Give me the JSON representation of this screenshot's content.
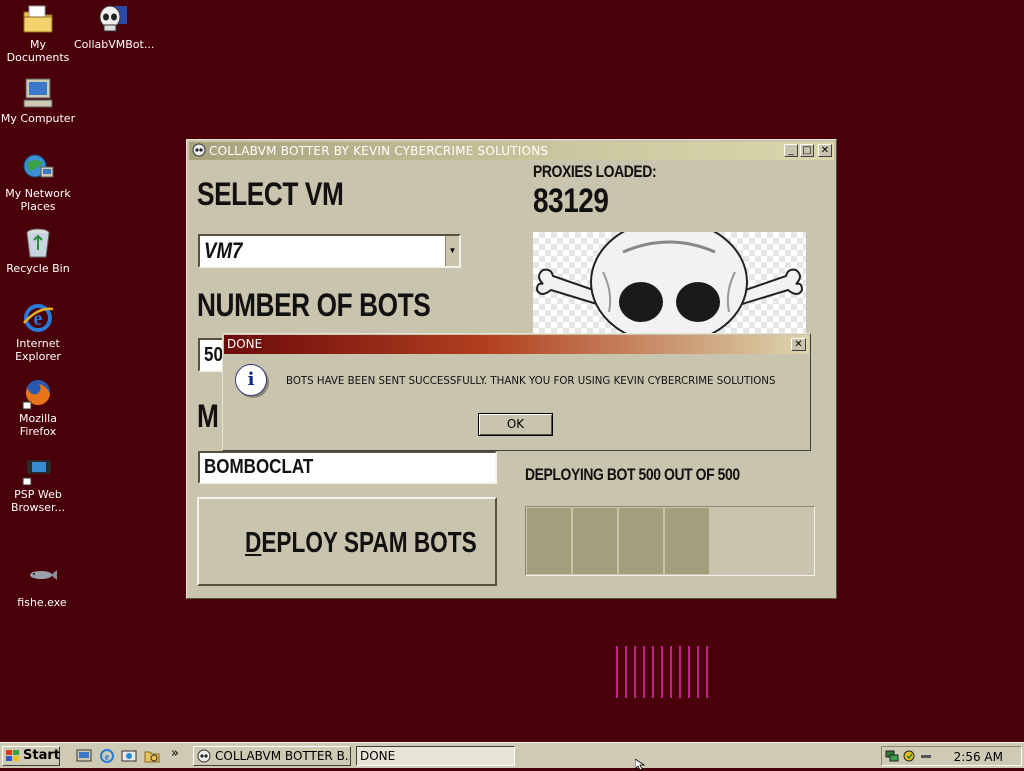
{
  "desktop": {
    "icons": [
      {
        "label": "My Documents",
        "icon": "folder-documents-icon"
      },
      {
        "label": "CollabVMBot...",
        "icon": "skull-app-icon"
      },
      {
        "label": "My Computer",
        "icon": "computer-icon"
      },
      {
        "label": "My Network Places",
        "icon": "network-icon"
      },
      {
        "label": "Recycle Bin",
        "icon": "recycle-bin-icon"
      },
      {
        "label": "Internet Explorer",
        "icon": "internet-explorer-icon"
      },
      {
        "label": "Mozilla Firefox",
        "icon": "firefox-icon"
      },
      {
        "label": "PSP Web Browser...",
        "icon": "psp-icon"
      },
      {
        "label": "fishe.exe",
        "icon": "fish-icon"
      }
    ],
    "background_color": "#4a0009"
  },
  "window": {
    "title": "COLLABVM BOTTER BY KEVIN CYBERCRIME SOLUTIONS",
    "minimize_glyph": "_",
    "maximize_glyph": "□",
    "close_glyph": "✕",
    "select_vm_heading": "SELECT VM",
    "vm_value": "VM7",
    "dropdown_arrow": "▼",
    "number_of_bots_heading": "NUMBER OF BOTS",
    "bots_value_visible": "50",
    "message_heading_visible": "M",
    "message_value": "BOMBOCLAT",
    "deploy_button_label": "DEPLOY SPAM BOTS",
    "proxies_label": "PROXIES LOADED:",
    "proxies_count": "83129",
    "deploy_status": "DEPLOYING BOT 500 OUT OF 500",
    "progress_fraction": 0.64
  },
  "dialog": {
    "title": "DONE",
    "close_glyph": "✕",
    "icon": "info-icon",
    "message": "BOTS HAVE BEEN SENT SUCCESSFULLY. THANK YOU FOR USING KEVIN CYBERCRIME SOLUTIONS",
    "ok_label": "OK"
  },
  "taskbar": {
    "start_label": "Start",
    "quick_launch": [
      "show-desktop-icon",
      "internet-explorer-icon",
      "media-icon",
      "explorer-icon"
    ],
    "chevron": "»",
    "tasks": [
      {
        "label": "COLLABVM BOTTER B...",
        "active": false
      },
      {
        "label": "DONE",
        "active": true
      }
    ],
    "clock": "2:56 AM"
  }
}
